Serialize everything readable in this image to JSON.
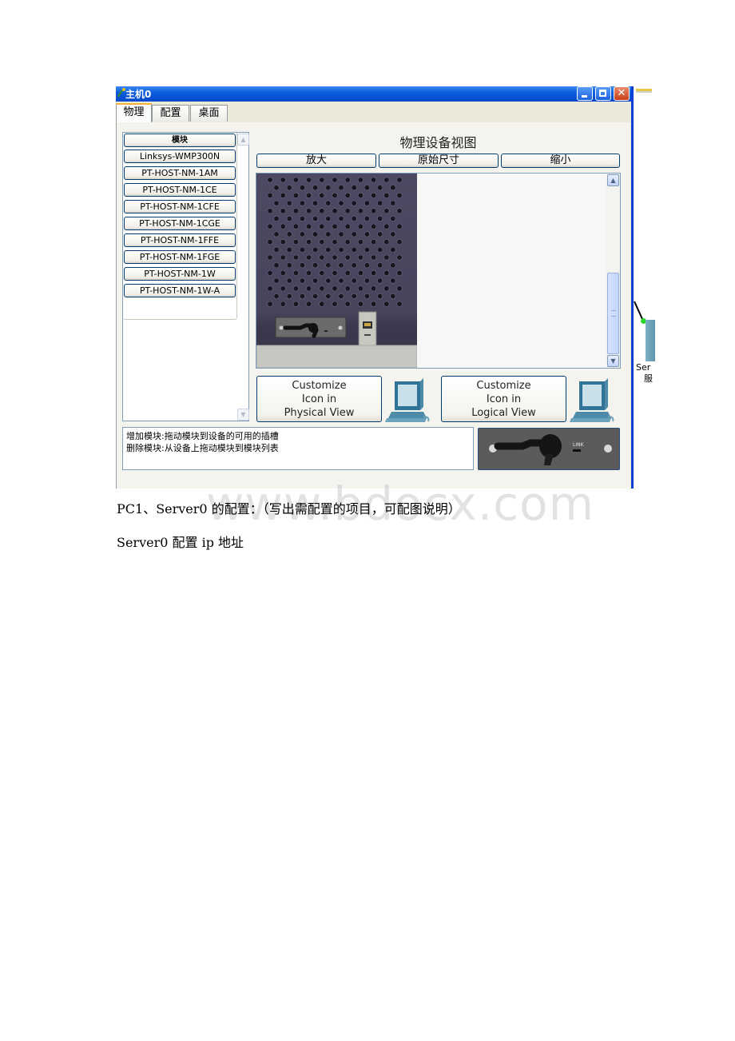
{
  "window": {
    "title": "主机0",
    "tabs": [
      {
        "label": "物理",
        "active": true
      },
      {
        "label": "配置",
        "active": false
      },
      {
        "label": "桌面",
        "active": false
      }
    ]
  },
  "modules": {
    "header": "模块",
    "items": [
      "Linksys-WMP300N",
      "PT-HOST-NM-1AM",
      "PT-HOST-NM-1CE",
      "PT-HOST-NM-1CFE",
      "PT-HOST-NM-1CGE",
      "PT-HOST-NM-1FFE",
      "PT-HOST-NM-1FGE",
      "PT-HOST-NM-1W",
      "PT-HOST-NM-1W-A"
    ]
  },
  "physical_view": {
    "title": "物理设备视图",
    "zoom_in": "放大",
    "original_size": "原始尺寸",
    "zoom_out": "缩小"
  },
  "customize": {
    "physical": [
      "Customize",
      "Icon in",
      "Physical View"
    ],
    "logical": [
      "Customize",
      "Icon in",
      "Logical View"
    ]
  },
  "help": {
    "line1": "增加模块:拖动模块到设备的可用的插槽",
    "line2": "删除模块:从设备上拖动模块到模块列表"
  },
  "module_preview": {
    "label": "LINK"
  },
  "background": {
    "server_label_1": "Ser",
    "server_label_2": "服"
  },
  "document": {
    "line1": "PC1、Server0 的配置：（写出需配置的项目，可配图说明）",
    "line2": "Server0 配置 ip 地址",
    "watermark": "www.bdocx.com"
  },
  "colors": {
    "titlebar": "#0548cc",
    "window_bg": "#ece9d8",
    "device_case": "#4a4860",
    "active_tab_accent": "#f5b233"
  }
}
